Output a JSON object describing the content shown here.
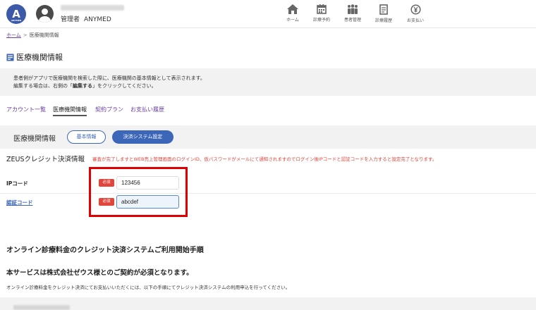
{
  "header": {
    "logo_text": "A",
    "logo_sub": "ANYMED",
    "role": "管理者",
    "user_name": "ANYMED",
    "nav": [
      {
        "label": "ホーム",
        "icon": "home-icon"
      },
      {
        "label": "診療予約",
        "icon": "calendar-icon"
      },
      {
        "label": "患者管理",
        "icon": "people-icon"
      },
      {
        "label": "診療履歴",
        "icon": "document-icon"
      },
      {
        "label": "お支払い",
        "icon": "yen-icon"
      }
    ]
  },
  "breadcrumb": {
    "home": "ホーム",
    "separator": ">",
    "current": "医療機関情報"
  },
  "page_title": "医療機関情報",
  "info": {
    "line1": "患者側がアプリで医療機関を検索した際に、医療機関の基本情報として表示されます。",
    "line2_pre": "編集する場合は、右側の「",
    "line2_bold": "編集する",
    "line2_post": "」をクリックしてください。"
  },
  "tabs": [
    {
      "label": "アカウント一覧",
      "active": false
    },
    {
      "label": "医療機関情報",
      "active": true
    },
    {
      "label": "契約プラン",
      "active": false
    },
    {
      "label": "お支払い履歴",
      "active": false
    }
  ],
  "section": {
    "label": "医療機関情報",
    "basic_button": "基本情報",
    "payment_button": "決済システム設定"
  },
  "zeus": {
    "title": "ZEUSクレジット決済情報",
    "notice": "審査が完了しますとWEB売上管理画面のログインID、仮パスワードがメールにて通知されますのでログイン後IPコードと認証コードを入力すると設定完了となります。"
  },
  "form": {
    "ip_label": "IPコード",
    "ip_required": "必須",
    "ip_value": "123456",
    "auth_label": "認証コード",
    "auth_required": "必須",
    "auth_value": "abcdef"
  },
  "guide": {
    "heading": "オンライン診療料金のクレジット決済システムご利用開始手順",
    "subheading": "本サービスは株式会社ゼウス様とのご契約が必須となります。",
    "description": "オンライン診療料金をクレジット決済にてお支払いいただくには、以下の手順にてクレジット決済システムの利用申込を行ってください。"
  },
  "colors": {
    "accent": "#3c66b8",
    "link": "#6a3ea0",
    "required": "#e0463c",
    "highlight": "#e00000"
  }
}
